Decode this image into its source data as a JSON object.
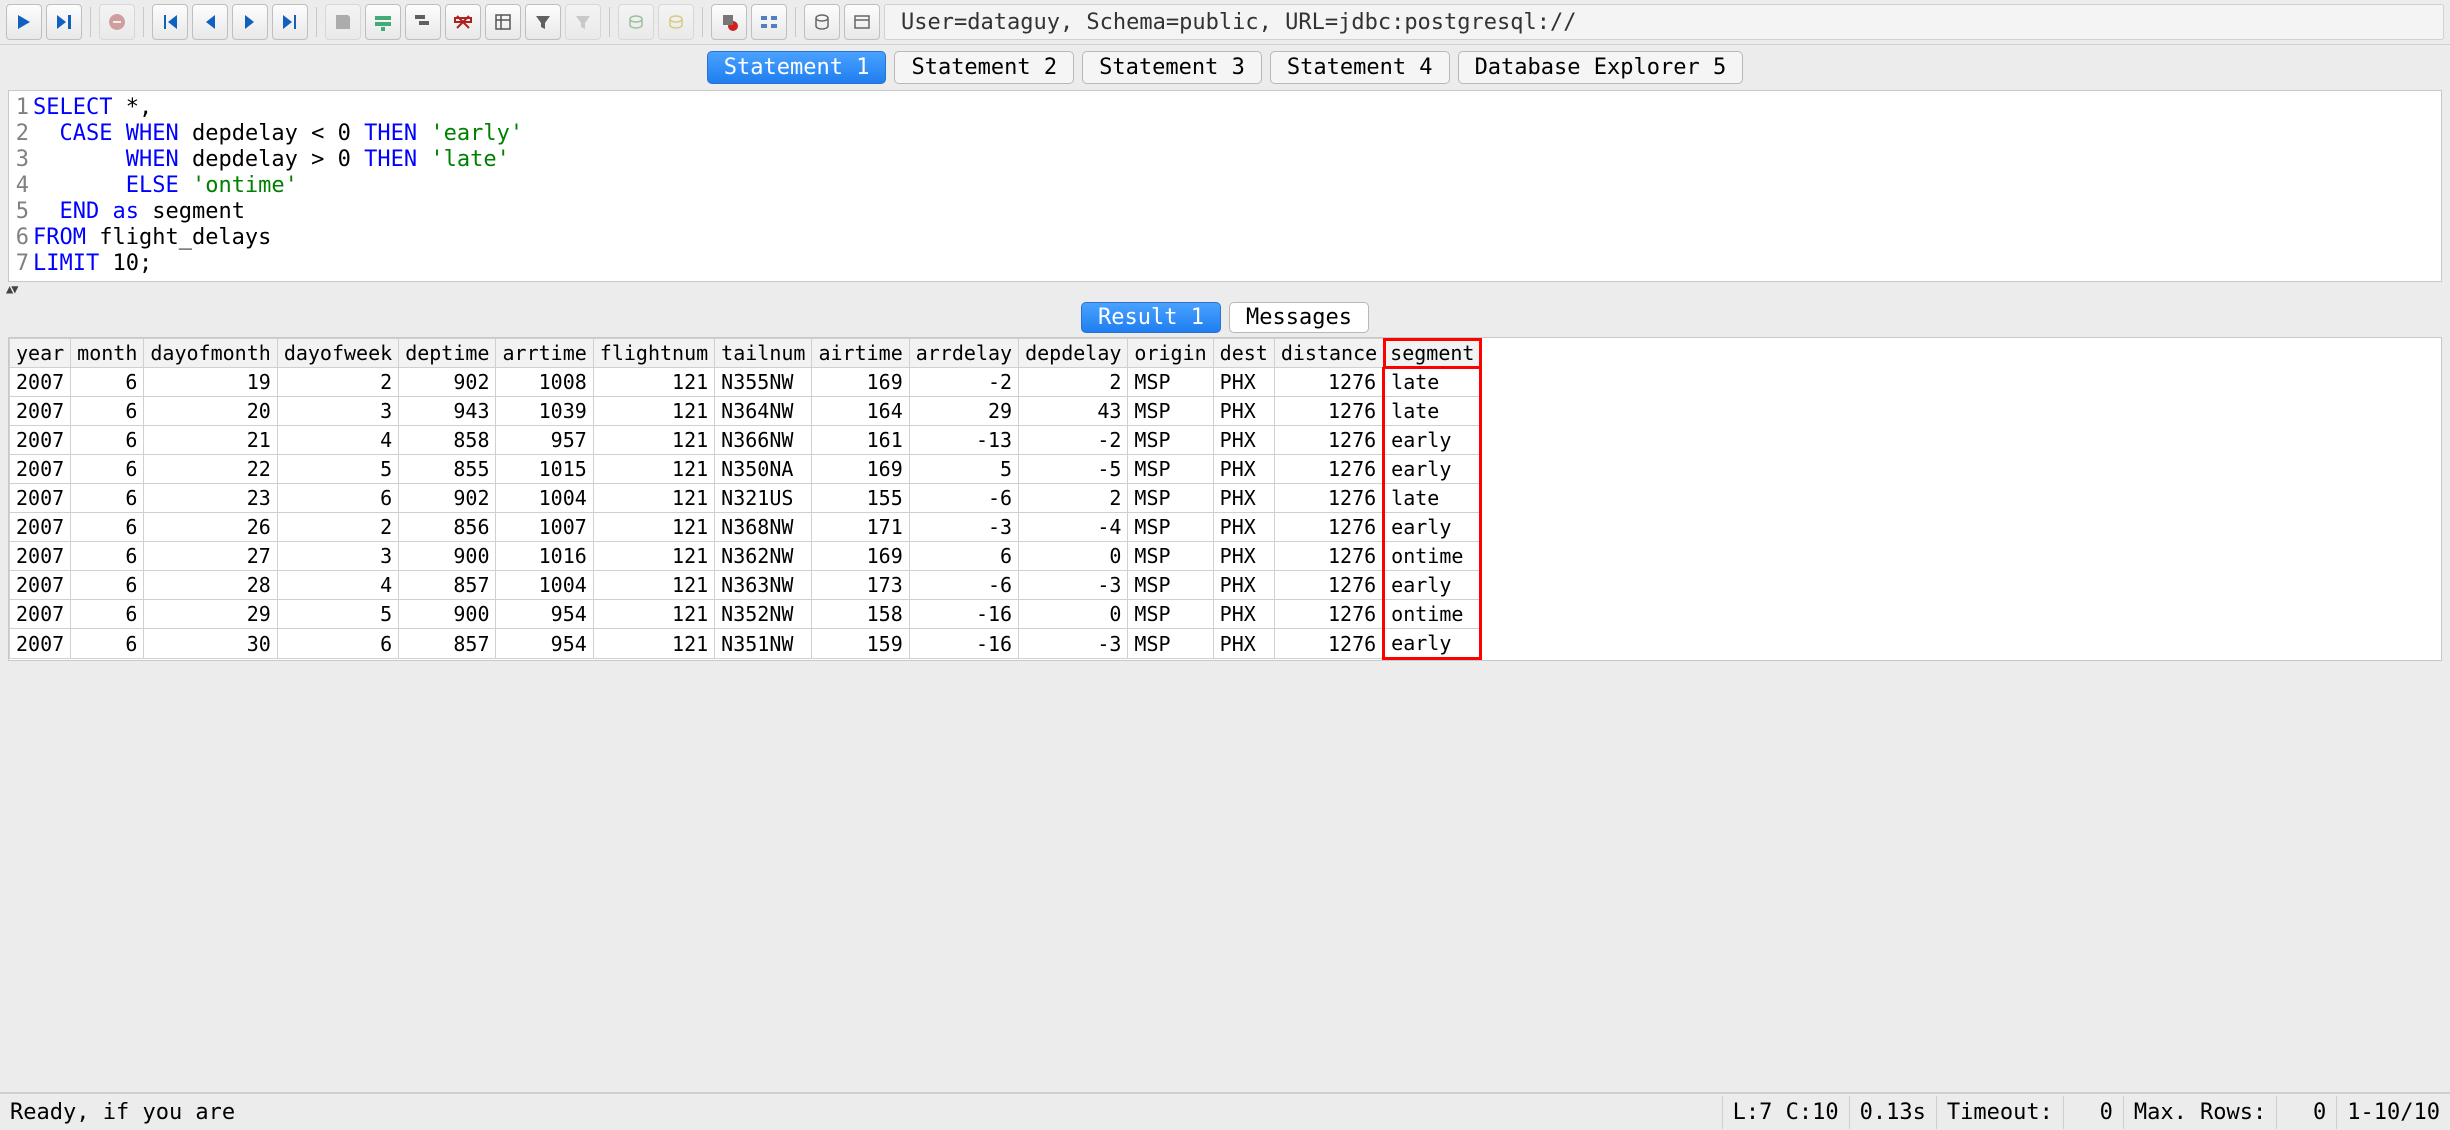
{
  "connection": "User=dataguy, Schema=public, URL=jdbc:postgresql://",
  "tabs": {
    "statements": [
      "Statement 1",
      "Statement 2",
      "Statement 3",
      "Statement 4",
      "Database Explorer 5"
    ],
    "active_statement": 0,
    "results": [
      "Result 1",
      "Messages"
    ],
    "active_result": 0
  },
  "sql": {
    "lines": [
      [
        {
          "t": "SELECT",
          "c": "kw"
        },
        {
          "t": " *,",
          "c": ""
        }
      ],
      [
        {
          "t": "  ",
          "c": ""
        },
        {
          "t": "CASE",
          "c": "kw"
        },
        {
          "t": " ",
          "c": ""
        },
        {
          "t": "WHEN",
          "c": "kw"
        },
        {
          "t": " depdelay < 0 ",
          "c": ""
        },
        {
          "t": "THEN",
          "c": "kw"
        },
        {
          "t": " ",
          "c": ""
        },
        {
          "t": "'early'",
          "c": "str"
        }
      ],
      [
        {
          "t": "       ",
          "c": ""
        },
        {
          "t": "WHEN",
          "c": "kw"
        },
        {
          "t": " depdelay > 0 ",
          "c": ""
        },
        {
          "t": "THEN",
          "c": "kw"
        },
        {
          "t": " ",
          "c": ""
        },
        {
          "t": "'late'",
          "c": "str"
        }
      ],
      [
        {
          "t": "       ",
          "c": ""
        },
        {
          "t": "ELSE",
          "c": "kw"
        },
        {
          "t": " ",
          "c": ""
        },
        {
          "t": "'ontime'",
          "c": "str"
        }
      ],
      [
        {
          "t": "  ",
          "c": ""
        },
        {
          "t": "END",
          "c": "kw"
        },
        {
          "t": " ",
          "c": ""
        },
        {
          "t": "as",
          "c": "kw"
        },
        {
          "t": " segment",
          "c": ""
        }
      ],
      [
        {
          "t": "FROM",
          "c": "kw"
        },
        {
          "t": " flight_delays",
          "c": ""
        }
      ],
      [
        {
          "t": "LIMIT",
          "c": "kw"
        },
        {
          "t": " 10;",
          "c": ""
        }
      ]
    ]
  },
  "grid": {
    "columns": [
      {
        "name": "year",
        "align": "num"
      },
      {
        "name": "month",
        "align": "num"
      },
      {
        "name": "dayofmonth",
        "align": "num"
      },
      {
        "name": "dayofweek",
        "align": "num"
      },
      {
        "name": "deptime",
        "align": "num"
      },
      {
        "name": "arrtime",
        "align": "num"
      },
      {
        "name": "flightnum",
        "align": "num"
      },
      {
        "name": "tailnum",
        "align": "txt"
      },
      {
        "name": "airtime",
        "align": "num"
      },
      {
        "name": "arrdelay",
        "align": "num"
      },
      {
        "name": "depdelay",
        "align": "num"
      },
      {
        "name": "origin",
        "align": "txt"
      },
      {
        "name": "dest",
        "align": "txt"
      },
      {
        "name": "distance",
        "align": "num"
      },
      {
        "name": "segment",
        "align": "txt",
        "highlight": true
      }
    ],
    "rows": [
      [
        2007,
        6,
        19,
        2,
        902,
        1008,
        121,
        "N355NW",
        169,
        -2,
        2,
        "MSP",
        "PHX",
        1276,
        "late"
      ],
      [
        2007,
        6,
        20,
        3,
        943,
        1039,
        121,
        "N364NW",
        164,
        29,
        43,
        "MSP",
        "PHX",
        1276,
        "late"
      ],
      [
        2007,
        6,
        21,
        4,
        858,
        957,
        121,
        "N366NW",
        161,
        -13,
        -2,
        "MSP",
        "PHX",
        1276,
        "early"
      ],
      [
        2007,
        6,
        22,
        5,
        855,
        1015,
        121,
        "N350NA",
        169,
        5,
        -5,
        "MSP",
        "PHX",
        1276,
        "early"
      ],
      [
        2007,
        6,
        23,
        6,
        902,
        1004,
        121,
        "N321US",
        155,
        -6,
        2,
        "MSP",
        "PHX",
        1276,
        "late"
      ],
      [
        2007,
        6,
        26,
        2,
        856,
        1007,
        121,
        "N368NW",
        171,
        -3,
        -4,
        "MSP",
        "PHX",
        1276,
        "early"
      ],
      [
        2007,
        6,
        27,
        3,
        900,
        1016,
        121,
        "N362NW",
        169,
        6,
        0,
        "MSP",
        "PHX",
        1276,
        "ontime"
      ],
      [
        2007,
        6,
        28,
        4,
        857,
        1004,
        121,
        "N363NW",
        173,
        -6,
        -3,
        "MSP",
        "PHX",
        1276,
        "early"
      ],
      [
        2007,
        6,
        29,
        5,
        900,
        954,
        121,
        "N352NW",
        158,
        -16,
        0,
        "MSP",
        "PHX",
        1276,
        "ontime"
      ],
      [
        2007,
        6,
        30,
        6,
        857,
        954,
        121,
        "N351NW",
        159,
        -16,
        -3,
        "MSP",
        "PHX",
        1276,
        "early"
      ]
    ]
  },
  "status": {
    "message": "Ready, if you are",
    "cursor": "L:7 C:10",
    "elapsed": "0.13s",
    "timeout_label": "Timeout:",
    "timeout_value": "0",
    "maxrows_label": "Max. Rows:",
    "maxrows_value": "0",
    "range": "1-10/10"
  },
  "toolbar_icons": [
    {
      "name": "run-icon"
    },
    {
      "name": "run-current-icon"
    },
    {
      "sep": true
    },
    {
      "name": "stop-icon",
      "disabled": true
    },
    {
      "sep": true
    },
    {
      "name": "first-icon"
    },
    {
      "name": "prev-icon"
    },
    {
      "name": "next-icon"
    },
    {
      "name": "last-icon"
    },
    {
      "sep": true
    },
    {
      "name": "save-icon",
      "disabled": true
    },
    {
      "name": "insert-row-icon"
    },
    {
      "name": "copy-row-icon"
    },
    {
      "name": "delete-row-icon"
    },
    {
      "name": "select-columns-icon"
    },
    {
      "name": "filter-icon"
    },
    {
      "name": "clear-filter-icon",
      "disabled": true
    },
    {
      "sep": true
    },
    {
      "name": "commit-icon",
      "disabled": true
    },
    {
      "name": "rollback-icon",
      "disabled": true
    },
    {
      "sep": true
    },
    {
      "name": "stop-execution-icon"
    },
    {
      "name": "explain-icon"
    },
    {
      "sep": true
    },
    {
      "name": "db-object-icon"
    },
    {
      "name": "db-browse-icon"
    }
  ]
}
